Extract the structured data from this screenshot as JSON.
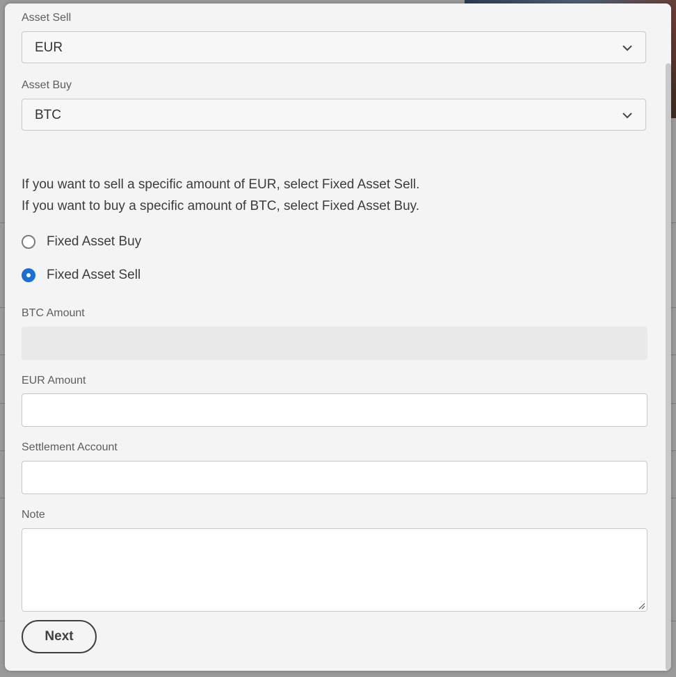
{
  "form": {
    "asset_sell": {
      "label": "Asset Sell",
      "value": "EUR"
    },
    "asset_buy": {
      "label": "Asset Buy",
      "value": "BTC"
    },
    "info_lines": [
      "If you want to sell a specific amount of EUR, select Fixed Asset Sell.",
      "If you want to buy a specific amount of BTC, select Fixed Asset Buy."
    ],
    "radio_options": [
      {
        "label": "Fixed Asset Buy",
        "selected": false
      },
      {
        "label": "Fixed Asset Sell",
        "selected": true
      }
    ],
    "btc_amount": {
      "label": "BTC Amount",
      "value": "",
      "disabled": true
    },
    "eur_amount": {
      "label": "EUR Amount",
      "value": ""
    },
    "settlement_account": {
      "label": "Settlement Account",
      "value": ""
    },
    "note": {
      "label": "Note",
      "value": ""
    },
    "next_label": "Next"
  },
  "colors": {
    "accent": "#1a6fd4",
    "modal_bg": "#f4f4f4",
    "disabled_input": "#e9e9e9"
  },
  "icons": [
    "chevron-down-icon",
    "resize-handle-icon"
  ]
}
